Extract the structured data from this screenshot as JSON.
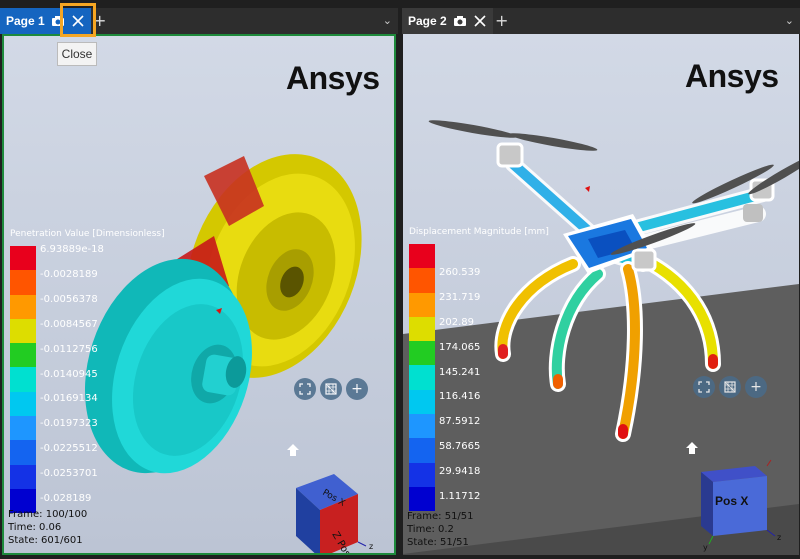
{
  "tabs": [
    {
      "label": "Page 1",
      "state": "active"
    },
    {
      "label": "Page 2",
      "state": "inactive"
    }
  ],
  "tooltip": "Close",
  "left_view": {
    "logo": "Ansys",
    "legend_title": "Penetration Value [Dimensionless]",
    "legend_labels": [
      "6.93889e-18",
      "-0.0028189",
      "-0.0056378",
      "-0.0084567",
      "-0.0112756",
      "-0.0140945",
      "-0.0169134",
      "-0.0197323",
      "-0.0225512",
      "-0.0253701",
      "-0.028189"
    ],
    "legend_colors": [
      "#e8001c",
      "#ff5500",
      "#ff9900",
      "#dddd00",
      "#22cc22",
      "#00e0d0",
      "#00c8f0",
      "#1e96ff",
      "#1464f0",
      "#1432e6",
      "#0000d0"
    ],
    "status": [
      "Frame: 100/100",
      "Time: 0.06",
      "State: 601/601"
    ]
  },
  "right_view": {
    "logo": "Ansys",
    "legend_title": "Displacement Magnitude [mm]",
    "legend_labels": [
      "",
      "260.539",
      "231.719",
      "202.89",
      "174.065",
      "145.241",
      "116.416",
      "87.5912",
      "58.7665",
      "29.9418",
      "1.11712"
    ],
    "legend_colors": [
      "#e8001c",
      "#ff5500",
      "#ff9900",
      "#dddd00",
      "#22cc22",
      "#00e0d0",
      "#00c8f0",
      "#1e96ff",
      "#1464f0",
      "#1432e6",
      "#0000d0"
    ],
    "cube_label": "Pos X",
    "status": [
      "Frame: 51/51",
      "Time: 0.2",
      "State: 51/51"
    ]
  }
}
